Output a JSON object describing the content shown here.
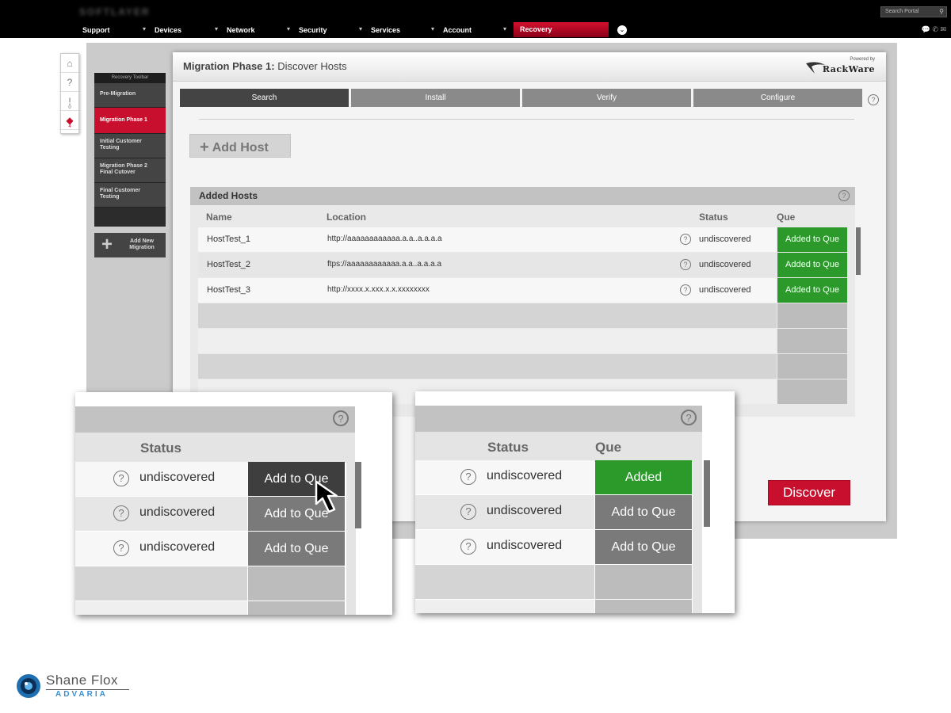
{
  "topbar": {
    "logo_text": "SOFTLAYER",
    "search_placeholder": "Search Portal",
    "nav": [
      {
        "label": "Support"
      },
      {
        "label": "Devices"
      },
      {
        "label": "Network"
      },
      {
        "label": "Security"
      },
      {
        "label": "Services"
      },
      {
        "label": "Account"
      }
    ],
    "active_nav": "Recovery",
    "caret": "▾"
  },
  "side_rail": {
    "alerts_count": "0",
    "tags_count": "4"
  },
  "recovery_toolbar": {
    "title": "Recovery Toolbar",
    "items": [
      {
        "label": "Pre-Migration"
      },
      {
        "label": "Migration Phase 1"
      },
      {
        "label": "Initial Customer Testing"
      },
      {
        "label": "Migration Phase 2 Final Cutover"
      },
      {
        "label": "Final Customer Testing"
      }
    ],
    "add_label": "Add New Migration"
  },
  "main": {
    "title_bold": "Migration Phase 1:",
    "title_rest": " Discover Hosts",
    "powered_by": "Powered by",
    "brand": "RackWare",
    "steps": [
      {
        "label": "Search"
      },
      {
        "label": "Install"
      },
      {
        "label": "Verify"
      },
      {
        "label": "Configure"
      }
    ],
    "help": "?",
    "add_host_label": "Add Host",
    "hosts": {
      "title": "Added Hosts",
      "columns": {
        "name": "Name",
        "location": "Location",
        "status": "Status",
        "que": "Que"
      },
      "rows": [
        {
          "name": "HostTest_1",
          "location": "http://aaaaaaaaaaaa.a.a..a.a.a.a",
          "status": "undiscovered",
          "que": "Added to Que"
        },
        {
          "name": "HostTest_2",
          "location": "ftps://aaaaaaaaaaaa.a.a..a.a.a.a",
          "status": "undiscovered",
          "que": "Added to Que"
        },
        {
          "name": "HostTest_3",
          "location": "http://xxxx.x.xxx.x.x.xxxxxxxx",
          "status": "undiscovered",
          "que": "Added to Que"
        }
      ]
    },
    "discover_label": "Discover"
  },
  "zoom_left": {
    "status_header": "Status",
    "rows": [
      {
        "status": "undiscovered",
        "button": "Add to Que"
      },
      {
        "status": "undiscovered",
        "button": "Add to Que"
      },
      {
        "status": "undiscovered",
        "button": "Add to Que"
      }
    ]
  },
  "zoom_right": {
    "status_header": "Status",
    "que_header": "Que",
    "rows": [
      {
        "status": "undiscovered",
        "button": "Added"
      },
      {
        "status": "undiscovered",
        "button": "Add to Que"
      },
      {
        "status": "undiscovered",
        "button": "Add to Que"
      }
    ]
  },
  "credit": {
    "name": "Shane Flox",
    "company": "ADVARIA"
  }
}
